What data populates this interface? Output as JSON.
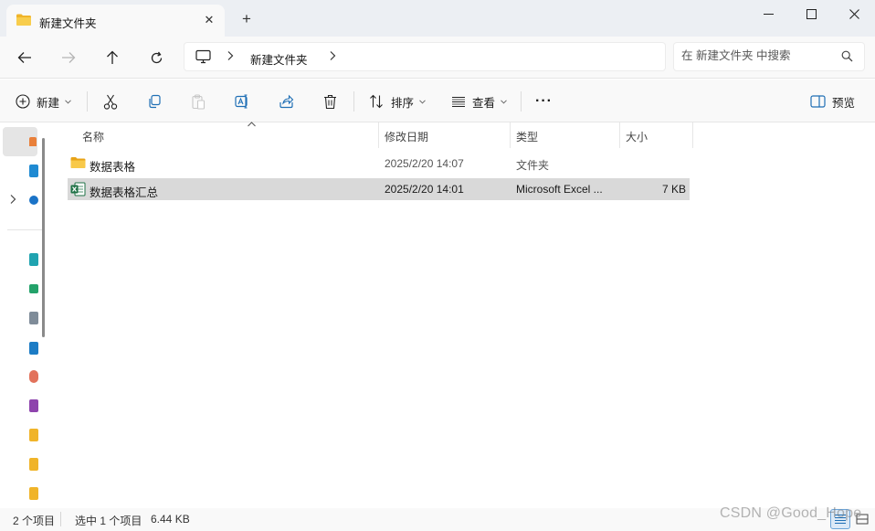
{
  "window": {
    "tab_title": "新建文件夹",
    "new_tab_symbol": "+"
  },
  "address": {
    "crumb": "新建文件夹",
    "search_placeholder": "在 新建文件夹 中搜索"
  },
  "toolbar": {
    "new_label": "新建",
    "sort_label": "排序",
    "view_label": "查看",
    "more_label": "···",
    "preview_label": "预览"
  },
  "columns": {
    "name": "名称",
    "date": "修改日期",
    "type": "类型",
    "size": "大小"
  },
  "files": [
    {
      "name": "数据表格",
      "date": "2025/2/20 14:07",
      "type": "文件夹",
      "size": "",
      "icon": "folder-icon"
    },
    {
      "name": "数据表格汇总",
      "date": "2025/2/20 14:01",
      "type": "Microsoft Excel ...",
      "size": "7 KB",
      "icon": "excel-file-icon"
    }
  ],
  "status": {
    "item_count": "2 个项目",
    "selection": "选中 1 个项目",
    "selection_size": "6.44 KB"
  },
  "watermark": "CSDN @Good_Hope",
  "colors": {
    "folder": "#f0b429",
    "excel": "#1e7145",
    "selected_row": "#d9d9d9"
  }
}
